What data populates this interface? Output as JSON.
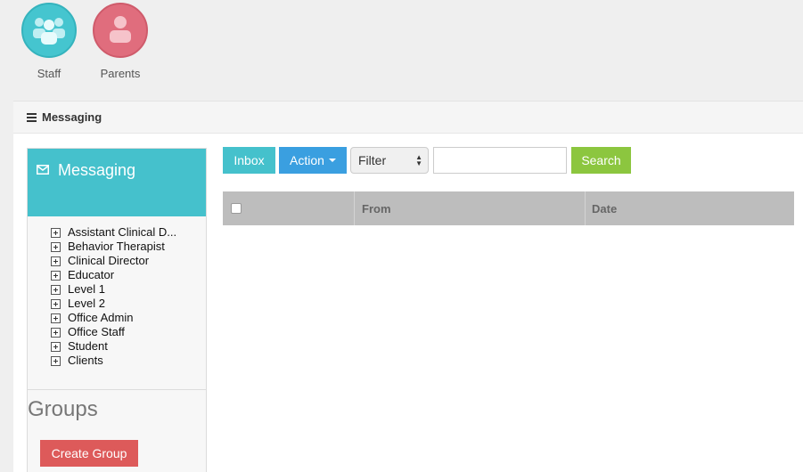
{
  "quick_links": [
    {
      "label": "Staff",
      "icon": "users-group-icon",
      "color": "#45c5cf"
    },
    {
      "label": "Parents",
      "icon": "person-icon",
      "color": "#e06d7d"
    }
  ],
  "panel": {
    "title": "Messaging"
  },
  "sidebar": {
    "title": "Messaging",
    "tree": [
      "Assistant Clinical D...",
      "Behavior Therapist",
      "Clinical Director",
      "Educator",
      "Level 1",
      "Level 2",
      "Office Admin",
      "Office Staff",
      "Student",
      "Clients"
    ],
    "groups_title": "Groups",
    "create_group_label": "Create Group"
  },
  "toolbar": {
    "inbox_label": "Inbox",
    "action_label": "Action",
    "filter_value": "Filter",
    "search_value": "",
    "search_label": "Search"
  },
  "table": {
    "columns": [
      "",
      "From",
      "Date"
    ]
  },
  "colors": {
    "teal": "#45c1cc",
    "blue": "#3a9fe0",
    "green": "#8cc63f",
    "red": "#dd5a5a"
  }
}
